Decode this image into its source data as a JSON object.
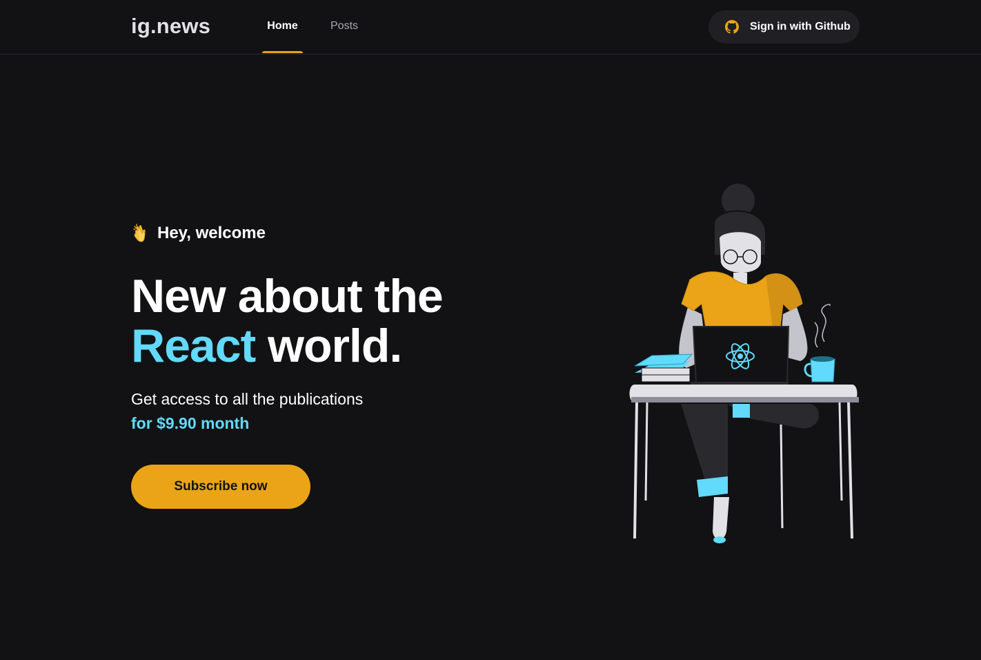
{
  "header": {
    "logo": "ig.news",
    "nav": [
      {
        "label": "Home",
        "active": true
      },
      {
        "label": "Posts",
        "active": false
      }
    ],
    "signin_label": "Sign in with Github",
    "signin_icon": "github-icon"
  },
  "hero": {
    "greeting_icon": "clapping-hands-icon",
    "greeting": "Hey, welcome",
    "headline_line1": "New about the",
    "headline_accent": "React",
    "headline_rest": " world.",
    "subtext": "Get access to all the publications",
    "price": "for $9.90 month",
    "subscribe_label": "Subscribe now"
  },
  "illustration": {
    "name": "avatar-illustration",
    "laptop_logo": "react-icon"
  },
  "colors": {
    "background": "#121214",
    "accent_yellow": "#eba417",
    "accent_cyan": "#61dafb",
    "button_dark": "#202024",
    "muted_text": "#a8a8b3"
  }
}
